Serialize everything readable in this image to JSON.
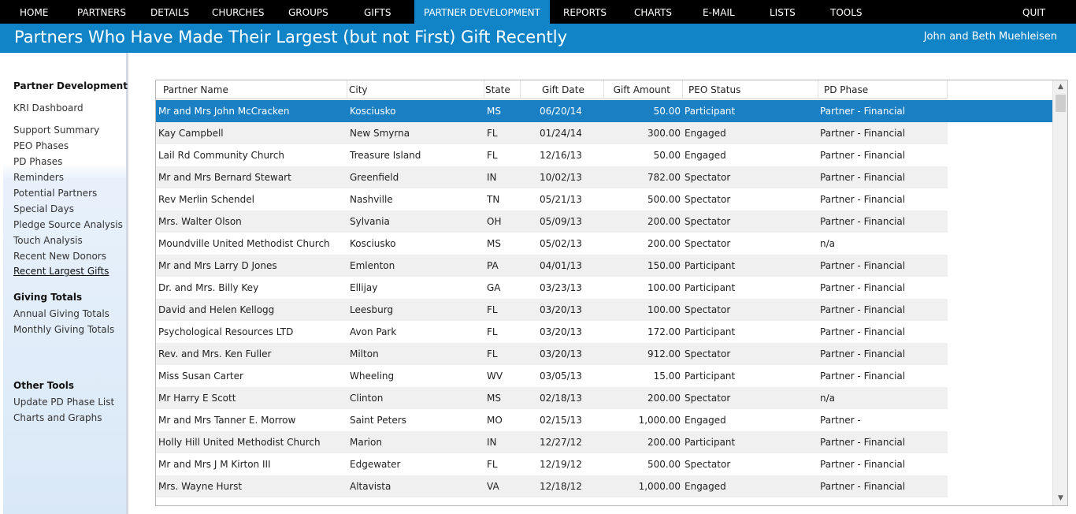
{
  "nav": {
    "items": [
      "HOME",
      "PARTNERS",
      "DETAILS",
      "CHURCHES",
      "GROUPS",
      "GIFTS",
      "PARTNER DEVELOPMENT",
      "REPORTS",
      "CHARTS",
      "E-MAIL",
      "LISTS",
      "TOOLS",
      "QUIT"
    ],
    "active": "PARTNER DEVELOPMENT"
  },
  "header": {
    "title": "Partners Who Have Made Their Largest (but not First) Gift Recently",
    "user": "John and Beth Muehleisen"
  },
  "sidebar": {
    "section1": "Partner Development",
    "dashboard": "KRI Dashboard",
    "items1": [
      "Support Summary",
      "PEO Phases",
      "PD Phases",
      "Reminders",
      "Potential Partners",
      "Special Days",
      "Pledge Source Analysis",
      "Touch Analysis",
      "Recent New Donors",
      "Recent Largest Gifts"
    ],
    "current": "Recent Largest Gifts",
    "section2": "Giving Totals",
    "items2": [
      "Annual Giving Totals",
      "Monthly Giving Totals"
    ],
    "section3": "Other Tools",
    "items3": [
      "Update PD Phase List",
      "Charts and Graphs"
    ]
  },
  "grid": {
    "columns": [
      "Partner Name",
      "City",
      "State",
      "Gift Date",
      "Gift Amount",
      "PEO Status",
      "PD Phase"
    ],
    "rows": [
      [
        "Mr and Mrs John McCracken",
        "Kosciusko",
        "MS",
        "06/20/14",
        "50.00",
        "Participant",
        "Partner - Financial"
      ],
      [
        "Kay Campbell",
        "New Smyrna",
        "FL",
        "01/24/14",
        "300.00",
        "Engaged",
        "Partner - Financial"
      ],
      [
        "Lail Rd Community Church",
        "Treasure Island",
        "FL",
        "12/16/13",
        "50.00",
        "Engaged",
        "Partner - Financial"
      ],
      [
        "Mr and Mrs Bernard Stewart",
        "Greenfield",
        "IN",
        "10/02/13",
        "782.00",
        "Spectator",
        "Partner - Financial"
      ],
      [
        "Rev Merlin Schendel",
        "Nashville",
        "TN",
        "05/21/13",
        "500.00",
        "Spectator",
        "Partner - Financial"
      ],
      [
        "Mrs. Walter Olson",
        "Sylvania",
        "OH",
        "05/09/13",
        "200.00",
        "Spectator",
        "Partner - Financial"
      ],
      [
        "Moundville United Methodist Church",
        "Kosciusko",
        "MS",
        "05/02/13",
        "200.00",
        "Spectator",
        "n/a"
      ],
      [
        "Mr and Mrs Larry D Jones",
        "Emlenton",
        "PA",
        "04/01/13",
        "150.00",
        "Participant",
        "Partner - Financial"
      ],
      [
        "Dr. and Mrs. Billy Key",
        "Ellijay",
        "GA",
        "03/23/13",
        "100.00",
        "Participant",
        "Partner - Financial"
      ],
      [
        "David and Helen Kellogg",
        "Leesburg",
        "FL",
        "03/20/13",
        "100.00",
        "Spectator",
        "Partner - Financial"
      ],
      [
        "Psychological Resources LTD",
        "Avon Park",
        "FL",
        "03/20/13",
        "172.00",
        "Participant",
        "Partner - Financial"
      ],
      [
        "Rev. and Mrs. Ken Fuller",
        "Milton",
        "FL",
        "03/20/13",
        "912.00",
        "Spectator",
        "Partner - Financial"
      ],
      [
        "Miss Susan Carter",
        "Wheeling",
        "WV",
        "03/05/13",
        "15.00",
        "Participant",
        "Partner - Financial"
      ],
      [
        "Mr Harry E Scott",
        "Clinton",
        "MS",
        "02/18/13",
        "200.00",
        "Spectator",
        "n/a"
      ],
      [
        "Mr and Mrs Tanner E. Morrow",
        "Saint Peters",
        "MO",
        "02/15/13",
        "1,000.00",
        "Engaged",
        "Partner -"
      ],
      [
        "Holly Hill United Methodist Church",
        "Marion",
        "IN",
        "12/27/12",
        "200.00",
        "Participant",
        "Partner - Financial"
      ],
      [
        "Mr and Mrs J M Kirton III",
        "Edgewater",
        "FL",
        "12/19/12",
        "500.00",
        "Spectator",
        "Partner - Financial"
      ],
      [
        "Mrs. Wayne Hurst",
        "Altavista",
        "VA",
        "12/18/12",
        "1,000.00",
        "Engaged",
        "Partner - Financial"
      ]
    ],
    "selected_row": 0
  },
  "icons": {
    "scroll_up": "▲",
    "scroll_down": "▼"
  },
  "colors": {
    "nav_bg": "#000000",
    "accent": "#1084c7",
    "selected_row": "#1a7fc3"
  }
}
